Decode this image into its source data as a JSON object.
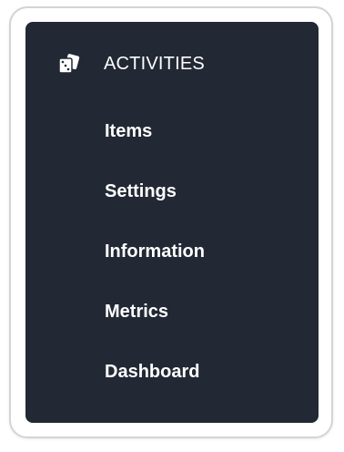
{
  "menu": {
    "header": {
      "label": "ACTIVITIES",
      "icon": "dice-icon"
    },
    "items": [
      {
        "label": "Items"
      },
      {
        "label": "Settings"
      },
      {
        "label": "Information"
      },
      {
        "label": "Metrics"
      },
      {
        "label": "Dashboard"
      }
    ]
  },
  "colors": {
    "panel_background": "#222834",
    "text": "#ffffff",
    "card_border": "#d4d4d4"
  }
}
